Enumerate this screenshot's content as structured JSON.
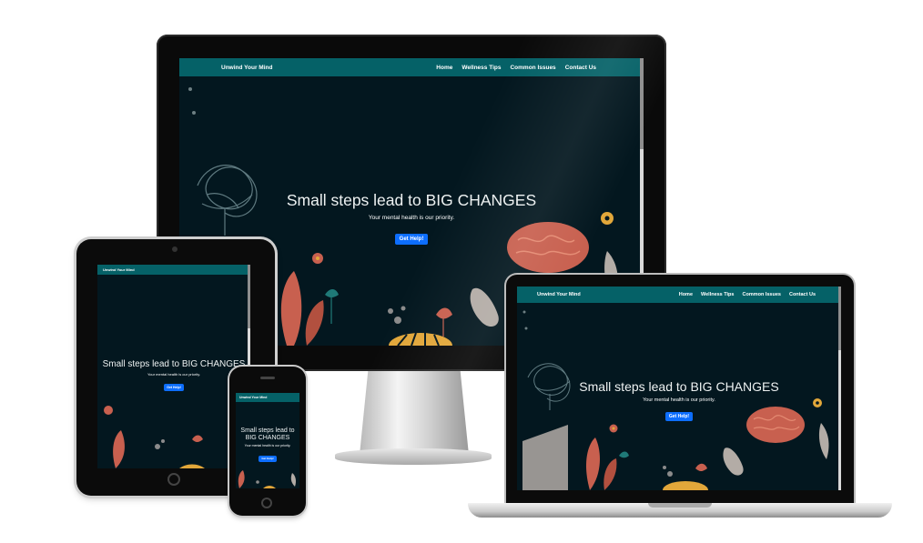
{
  "site": {
    "brand": "Unwind Your Mind",
    "nav": [
      "Home",
      "Wellness Tips",
      "Common Issues",
      "Contact Us"
    ],
    "hero_title": "Small steps lead to BIG CHANGES",
    "hero_title_line1": "Small steps lead to",
    "hero_title_line2": "BIG CHANGES",
    "hero_subtitle": "Your mental health is our priority.",
    "cta": "Get Help!"
  },
  "colors": {
    "navbar": "#056167",
    "background": "#03171f",
    "button": "#0d6efd",
    "accent_coral": "#c8604f",
    "accent_yellow": "#e2a73a",
    "accent_teal": "#1f7a78"
  }
}
